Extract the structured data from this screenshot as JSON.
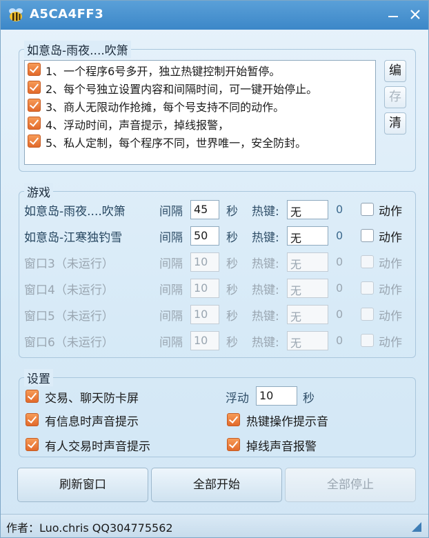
{
  "window": {
    "title": "A5CA4FF3"
  },
  "program_group": {
    "legend": "如意岛-雨夜....吹箫",
    "items": [
      {
        "label": "1、一个程序6号多开，独立热键控制开始暂停。",
        "checked": true
      },
      {
        "label": "2、每个号独立设置内容和间隔时间，可一键开始停止。",
        "checked": true
      },
      {
        "label": "3、商人无限动作抢摊，每个号支持不同的动作。",
        "checked": true
      },
      {
        "label": "4、浮动时间，声音提示，掉线报警，",
        "checked": true
      },
      {
        "label": "5、私人定制，每个程序不同，世界唯一，安全防封。",
        "checked": true
      }
    ],
    "buttons": {
      "edit": "编",
      "save": "存",
      "clear": "清"
    }
  },
  "game_group": {
    "legend": "游戏",
    "interval_label": "间隔",
    "seconds_label": "秒",
    "hotkey_label": "热键:",
    "action_label": "动作",
    "rows": [
      {
        "name": "如意岛-雨夜....吹箫",
        "interval": "45",
        "hotkey": "无",
        "count": "0",
        "enabled": true
      },
      {
        "name": "如意岛-江寒独钓雪",
        "interval": "50",
        "hotkey": "无",
        "count": "0",
        "enabled": true
      },
      {
        "name": "窗口3（未运行）",
        "interval": "10",
        "hotkey": "无",
        "count": "0",
        "enabled": false
      },
      {
        "name": "窗口4（未运行）",
        "interval": "10",
        "hotkey": "无",
        "count": "0",
        "enabled": false
      },
      {
        "name": "窗口5（未运行）",
        "interval": "10",
        "hotkey": "无",
        "count": "0",
        "enabled": false
      },
      {
        "name": "窗口6（未运行）",
        "interval": "10",
        "hotkey": "无",
        "count": "0",
        "enabled": false
      }
    ]
  },
  "settings_group": {
    "legend": "设置",
    "trade_chat_antifreeze": "交易、聊天防卡屏",
    "float_label": "浮动",
    "float_value": "10",
    "float_unit": "秒",
    "msg_sound": "有信息时声音提示",
    "hotkey_sound": "热键操作提示音",
    "trade_sound": "有人交易时声音提示",
    "disconnect_alarm": "掉线声音报警"
  },
  "buttons": {
    "refresh": "刷新窗口",
    "start_all": "全部开始",
    "stop_all": "全部停止"
  },
  "status": {
    "author": "作者：Luo.chris   QQ304775562"
  },
  "colors": {
    "title_bar": "#4a94d2",
    "checkbox": "#e8763a",
    "accent_text": "#25455f"
  }
}
